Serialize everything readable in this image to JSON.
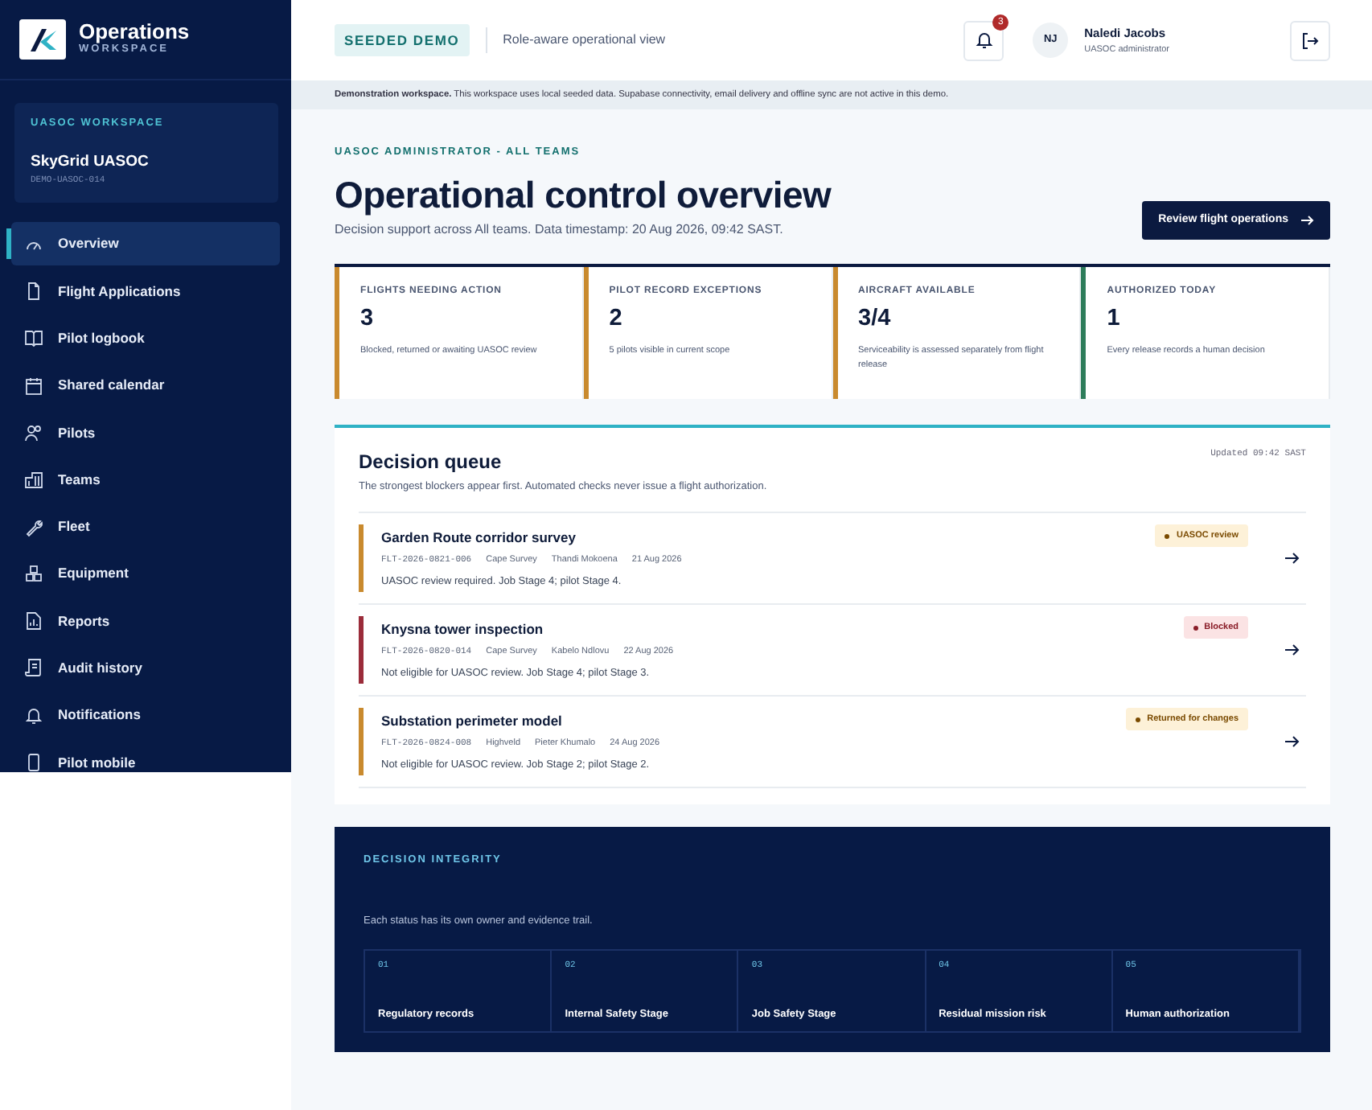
{
  "brand": {
    "title": "Operations",
    "subtitle": "WORKSPACE"
  },
  "workspace": {
    "label": "UASOC WORKSPACE",
    "name": "SkyGrid UASOC",
    "code": "DEMO-UASOC-014"
  },
  "sidebar": {
    "items": [
      {
        "label": "Overview",
        "selected": true
      },
      {
        "label": "Flight Applications",
        "selected": false
      },
      {
        "label": "Pilot logbook",
        "selected": false
      },
      {
        "label": "Shared calendar",
        "selected": false
      },
      {
        "label": "Pilots",
        "selected": false
      },
      {
        "label": "Teams",
        "selected": false
      },
      {
        "label": "Fleet",
        "selected": false
      },
      {
        "label": "Equipment",
        "selected": false
      },
      {
        "label": "Reports",
        "selected": false
      },
      {
        "label": "Audit history",
        "selected": false
      },
      {
        "label": "Notifications",
        "selected": false
      },
      {
        "label": "Pilot mobile",
        "selected": false
      }
    ]
  },
  "header": {
    "badge": "SEEDED DEMO",
    "subtitle": "Role-aware operational view",
    "notifications": "3",
    "user": {
      "initials": "NJ",
      "name": "Naledi Jacobs",
      "role": "UASOC administrator"
    }
  },
  "banner": {
    "text": "**Demonstration workspace.** This workspace uses local seeded data. Supabase connectivity, email delivery and offline sync are not active in this demo."
  },
  "page": {
    "eyebrow": "UASOC ADMINISTRATOR - ALL TEAMS",
    "title": "Operational control overview",
    "subtitle": "Decision support across All teams. Data timestamp: 20 Aug 2026, 09:42 SAST.",
    "action": "Review flight operations"
  },
  "metrics": [
    {
      "label": "FLIGHTS NEEDING ACTION",
      "value": "3",
      "note": "Blocked, returned or awaiting UASOC review",
      "color": "#c98a2e"
    },
    {
      "label": "PILOT RECORD EXCEPTIONS",
      "value": "2",
      "note": "5 pilots visible in current scope",
      "color": "#c98a2e"
    },
    {
      "label": "AIRCRAFT AVAILABLE",
      "value": "3/4",
      "note": "Serviceability is assessed separately from flight release",
      "color": "#c98a2e"
    },
    {
      "label": "AUTHORIZED TODAY",
      "value": "1",
      "note": "Every release records a human decision",
      "color": "#2e7d5b"
    }
  ],
  "queue": {
    "title": "Decision queue",
    "subtitle": "The strongest blockers appear first. Automated checks never issue a flight authorization.",
    "updated": "Updated 09:42 SAST",
    "items": [
      {
        "title": "Garden Route corridor survey",
        "ref": "FLT-2026-0821-006",
        "team": "Cape Survey",
        "pilot": "Thandi Mokoena",
        "date": "21 Aug 2026",
        "note": "UASOC review required. Job Stage 4; pilot Stage 4.",
        "status": "UASOC review",
        "kind": "review",
        "color": "#c98a2e"
      },
      {
        "title": "Knysna tower inspection",
        "ref": "FLT-2026-0820-014",
        "team": "Cape Survey",
        "pilot": "Kabelo Ndlovu",
        "date": "22 Aug 2026",
        "note": "Not eligible for UASOC review. Job Stage 4; pilot Stage 3.",
        "status": "Blocked",
        "kind": "blocked",
        "color": "#9b2c3a"
      },
      {
        "title": "Substation perimeter model",
        "ref": "FLT-2026-0824-008",
        "team": "Highveld",
        "pilot": "Pieter Khumalo",
        "date": "24 Aug 2026",
        "note": "Not eligible for UASOC review. Job Stage 2; pilot Stage 2.",
        "status": "Returned for changes",
        "kind": "returned",
        "color": "#c98a2e"
      }
    ]
  },
  "integrity": {
    "eyebrow": "DECISION INTEGRITY",
    "subtitle": "Each status has its own owner and evidence trail.",
    "steps": [
      {
        "number": "01",
        "title": "Regulatory records"
      },
      {
        "number": "02",
        "title": "Internal Safety Stage"
      },
      {
        "number": "03",
        "title": "Job Safety Stage"
      },
      {
        "number": "04",
        "title": "Residual mission risk"
      },
      {
        "number": "05",
        "title": "Human authorization"
      }
    ]
  }
}
